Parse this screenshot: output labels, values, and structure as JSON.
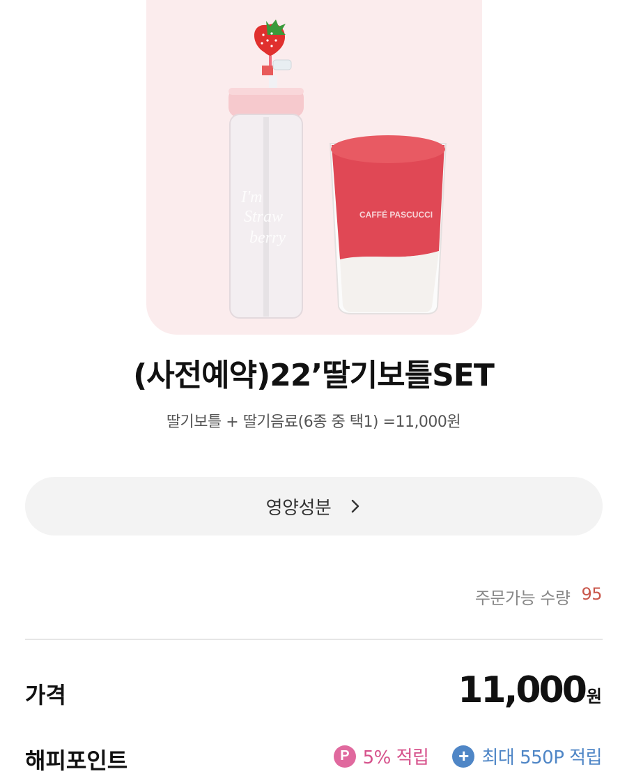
{
  "product": {
    "title": "(사전예약)22’딸기보틀SET",
    "description": "딸기보틀 + 딸기음료(6종 중 택1) =11,000원",
    "image_alt": "strawberry bottle and strawberry latte"
  },
  "nutrition": {
    "label": "영양성분"
  },
  "stock": {
    "label": "주문가능 수량",
    "count": "95"
  },
  "price": {
    "label": "가격",
    "value": "11,000",
    "unit": "원"
  },
  "points": {
    "label": "해피포인트",
    "rate_icon": "P",
    "rate_text": "5% 적립",
    "max_icon": "+",
    "max_text": "최대 550P 적립"
  },
  "colors": {
    "hero_bg": "#fbeced",
    "stock_count": "#c9574b",
    "point_pink": "#d6518b",
    "point_blue": "#4f86c6"
  }
}
